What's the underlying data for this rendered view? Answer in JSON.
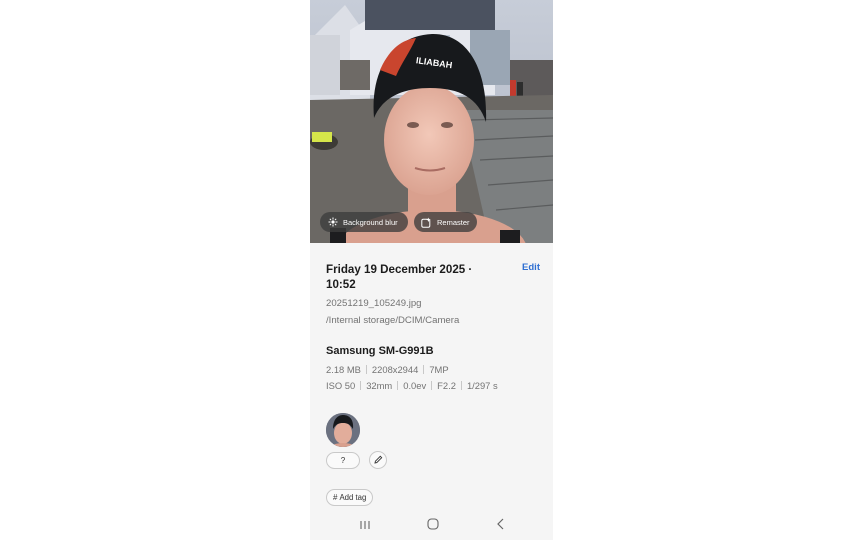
{
  "photo": {
    "cap_text": "ILIABAH",
    "actions": [
      {
        "label": "Background blur",
        "icon": "blur-sparkle-icon"
      },
      {
        "label": "Remaster",
        "icon": "remaster-icon"
      }
    ]
  },
  "details": {
    "date_time": "Friday 19 December 2025 · 10:52",
    "edit_label": "Edit",
    "filename": "20251219_105249.jpg",
    "path": "/Internal storage/DCIM/Camera",
    "device": "Samsung SM-G991B",
    "file_specs": [
      "2.18 MB",
      "2208x2944",
      "7MP"
    ],
    "camera_specs": [
      "ISO 50",
      "32mm",
      "0.0ev",
      "F2.2",
      "1/297 s"
    ]
  },
  "people": {
    "unknown_label": "?",
    "edit_icon": "pencil-icon"
  },
  "tags": {
    "add_label": "Add tag",
    "icon": "hash-icon"
  },
  "navigation": {
    "icons": [
      "recent-apps-icon",
      "home-icon",
      "back-icon"
    ]
  },
  "colors": {
    "accent": "#2f6fd2",
    "chip_bg": "#3c3c3c",
    "panel_bg": "#f5f5f5"
  }
}
